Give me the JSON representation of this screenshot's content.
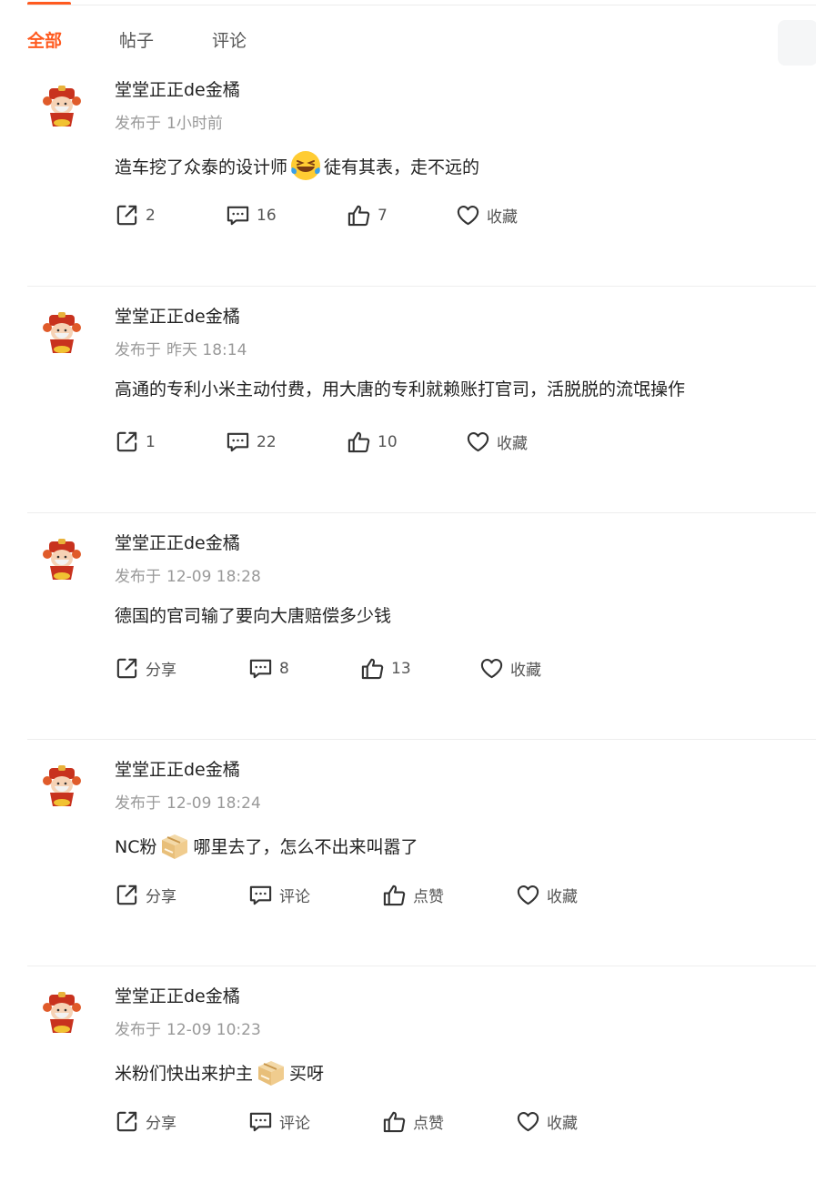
{
  "tabs": [
    {
      "label": "全部",
      "active": true
    },
    {
      "label": "帖子",
      "active": false
    },
    {
      "label": "评论",
      "active": false
    }
  ],
  "posts": [
    {
      "author": "堂堂正正de金橘",
      "time_prefix": "发布于",
      "time": "1小时前",
      "content_before": "造车挖了众泰的设计师",
      "emoji": "laughing-tears-emoji",
      "content_after": "徒有其表，走不远的",
      "share": "2",
      "comment": "16",
      "like": "7",
      "favorite": "收藏"
    },
    {
      "author": "堂堂正正de金橘",
      "time_prefix": "发布于",
      "time": "昨天 18:14",
      "content_before": "高通的专利小米主动付费，用大唐的专利就赖账打官司，活脱脱的流氓操作",
      "emoji": null,
      "content_after": "",
      "share": "1",
      "comment": "22",
      "like": "10",
      "favorite": "收藏"
    },
    {
      "author": "堂堂正正de金橘",
      "time_prefix": "发布于",
      "time": "12-09 18:28",
      "content_before": "德国的官司输了要向大唐赔偿多少钱",
      "emoji": null,
      "content_after": "",
      "share": "分享",
      "comment": "8",
      "like": "13",
      "favorite": "收藏"
    },
    {
      "author": "堂堂正正de金橘",
      "time_prefix": "发布于",
      "time": "12-09 18:24",
      "content_before": "NC粉",
      "emoji": "cardboard-box-emoji",
      "content_after": "哪里去了，怎么不出来叫嚣了",
      "share": "分享",
      "comment": "评论",
      "like": "点赞",
      "favorite": "收藏"
    },
    {
      "author": "堂堂正正de金橘",
      "time_prefix": "发布于",
      "time": "12-09 10:23",
      "content_before": "米粉们快出来护主",
      "emoji": "cardboard-box-emoji",
      "content_after": "买呀",
      "share": "分享",
      "comment": "评论",
      "like": "点赞",
      "favorite": "收藏"
    }
  ],
  "colors": {
    "accent": "#ff5a1f",
    "text": "#222222",
    "muted": "#999999",
    "action": "#555555"
  }
}
